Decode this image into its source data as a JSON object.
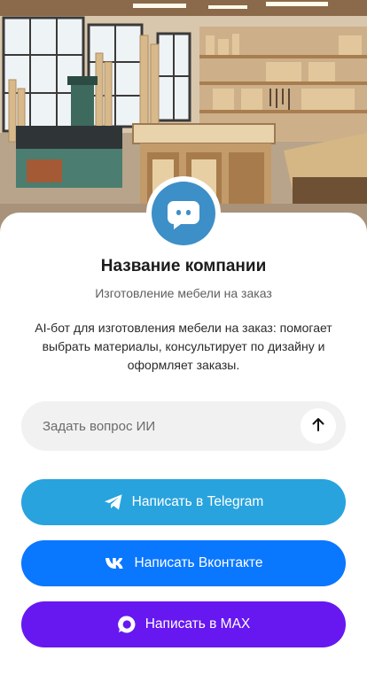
{
  "company": {
    "name": "Название компании",
    "tagline": "Изготовление мебели на заказ",
    "description": "AI-бот для изготовления мебели на заказ: помогает выбрать материалы, консультирует по дизайну и оформляет заказы."
  },
  "hero": {
    "image_icon": "workshop-illustration"
  },
  "avatar": {
    "icon": "chat-bot-icon",
    "color": "#3d8fc8"
  },
  "ask": {
    "placeholder": "Задать вопрос ИИ",
    "send_icon": "arrow-up-icon"
  },
  "buttons": [
    {
      "label": "Написать в Telegram",
      "icon": "telegram-icon",
      "color": "#28a3de"
    },
    {
      "label": "Написать Вконтакте",
      "icon": "vk-icon",
      "color": "#0a77ff"
    },
    {
      "label": "Написать в MAX",
      "icon": "max-icon",
      "color": "#6718f0"
    }
  ]
}
